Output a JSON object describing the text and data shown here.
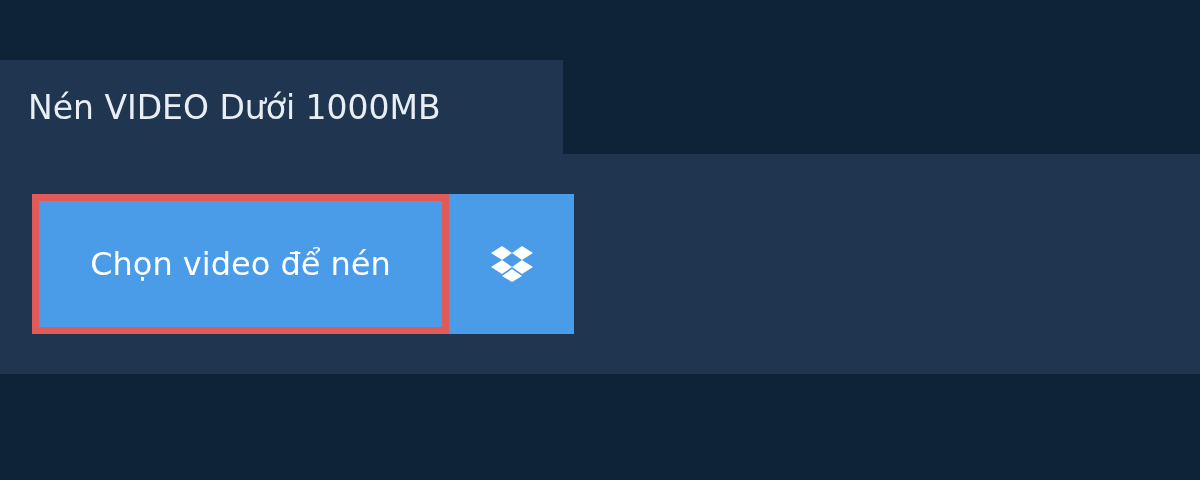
{
  "tab": {
    "title": "Nén VIDEO Dưới 1000MB"
  },
  "upload": {
    "button_label": "Chọn video để nén",
    "highlighted": true
  }
}
